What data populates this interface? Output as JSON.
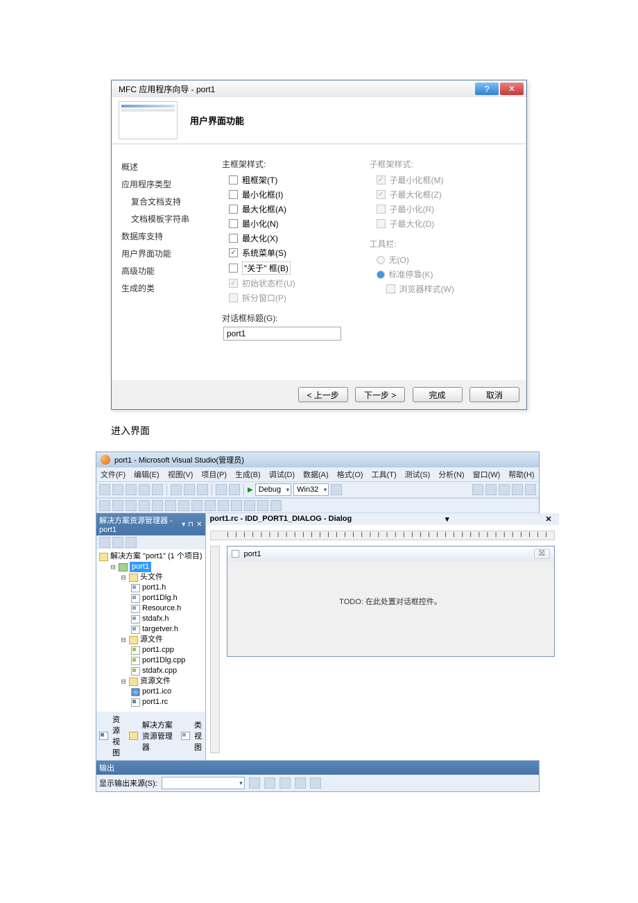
{
  "wizard": {
    "title": "MFC 应用程序向导 - port1",
    "header": "用户界面功能",
    "nav": [
      "概述",
      "应用程序类型",
      "复合文档支持",
      "文档模板字符串",
      "数据库支持",
      "用户界面功能",
      "高级功能",
      "生成的类"
    ],
    "groupMain": "主框架样式:",
    "mainOptions": {
      "thickFrame": "粗框架(T)",
      "minBox": "最小化框(I)",
      "maxBox": "最大化框(A)",
      "min": "最小化(N)",
      "max": "最大化(X)",
      "sysMenu": "系统菜单(S)",
      "about": "\"关于\" 框(B)",
      "initStatus": "初始状态栏(U)",
      "splitWin": "拆分窗口(P)"
    },
    "dlgTitleLabel": "对话框标题(G):",
    "dlgTitleValue": "port1",
    "groupChild": "子框架样式:",
    "childOptions": {
      "childMinBox": "子最小化框(M)",
      "childMaxBox": "子最大化框(Z)",
      "childMin": "子最小化(R)",
      "childMax": "子最大化(D)"
    },
    "groupToolbar": "工具栏:",
    "toolbarOptions": {
      "none": "无(O)",
      "std": "标准停靠(K)",
      "browser": "浏览器样式(W)"
    },
    "buttons": {
      "prev": "< 上一步",
      "next": "下一步 >",
      "finish": "完成",
      "cancel": "取消"
    }
  },
  "caption": "进入界面",
  "vs": {
    "title": "port1 - Microsoft Visual Studio(管理员)",
    "menu": [
      "文件(F)",
      "编辑(E)",
      "视图(V)",
      "项目(P)",
      "生成(B)",
      "调试(D)",
      "数据(A)",
      "格式(O)",
      "工具(T)",
      "测试(S)",
      "分析(N)",
      "窗口(W)",
      "帮助(H)"
    ],
    "config": "Debug",
    "platform": "Win32",
    "solExplorer": {
      "panelTitle": "解决方案资源管理器 - port1",
      "solution": "解决方案 \"port1\" (1 个项目)",
      "project": "port1",
      "folderHeaders": "头文件",
      "headers": [
        "port1.h",
        "port1Dlg.h",
        "Resource.h",
        "stdafx.h",
        "targetver.h"
      ],
      "folderSources": "源文件",
      "sources": [
        "port1.cpp",
        "port1Dlg.cpp",
        "stdafx.cpp"
      ],
      "folderResources": "资源文件",
      "resources": [
        "port1.ico",
        "port1.rc"
      ],
      "tabs": [
        "资源视图",
        "解决方案资源管理器",
        "类视图"
      ]
    },
    "designer": {
      "tabTitle": "port1.rc - IDD_PORT1_DIALOG - Dialog",
      "dlgName": "port1",
      "todo": "TODO: 在此处置对话框控件。"
    },
    "output": {
      "panelTitle": "输出",
      "showFrom": "显示输出来源(S):"
    }
  }
}
